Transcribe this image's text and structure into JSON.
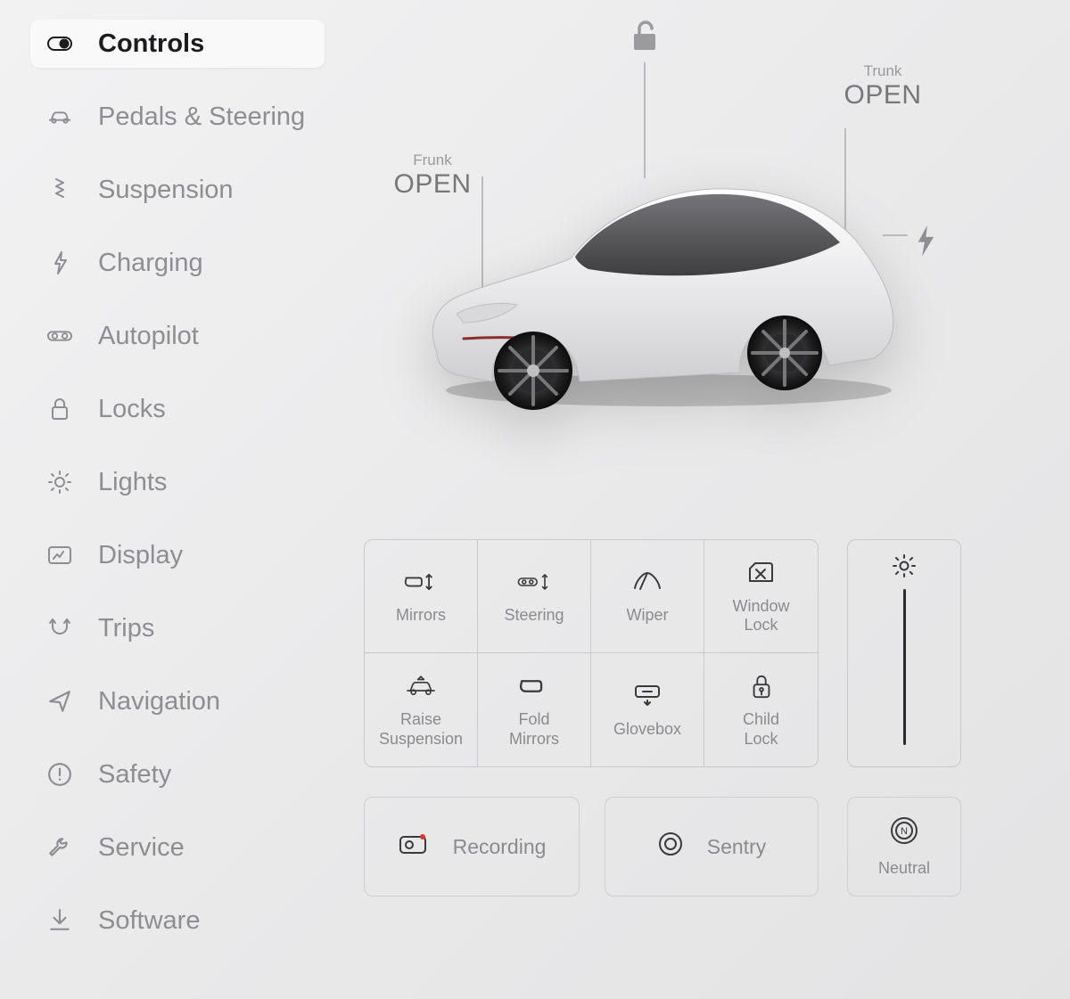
{
  "sidebar": {
    "items": [
      {
        "label": "Controls"
      },
      {
        "label": "Pedals & Steering"
      },
      {
        "label": "Suspension"
      },
      {
        "label": "Charging"
      },
      {
        "label": "Autopilot"
      },
      {
        "label": "Locks"
      },
      {
        "label": "Lights"
      },
      {
        "label": "Display"
      },
      {
        "label": "Trips"
      },
      {
        "label": "Navigation"
      },
      {
        "label": "Safety"
      },
      {
        "label": "Service"
      },
      {
        "label": "Software"
      }
    ]
  },
  "car": {
    "frunk": {
      "name": "Frunk",
      "action": "OPEN"
    },
    "trunk": {
      "name": "Trunk",
      "action": "OPEN"
    }
  },
  "controls": {
    "tiles": [
      {
        "label": "Mirrors"
      },
      {
        "label": "Steering"
      },
      {
        "label": "Wiper"
      },
      {
        "label": "Window\nLock"
      },
      {
        "label": "Raise\nSuspension"
      },
      {
        "label": "Fold\nMirrors"
      },
      {
        "label": "Glovebox"
      },
      {
        "label": "Child\nLock"
      }
    ]
  },
  "bottom": {
    "recording": "Recording",
    "sentry": "Sentry",
    "neutral": "Neutral"
  }
}
